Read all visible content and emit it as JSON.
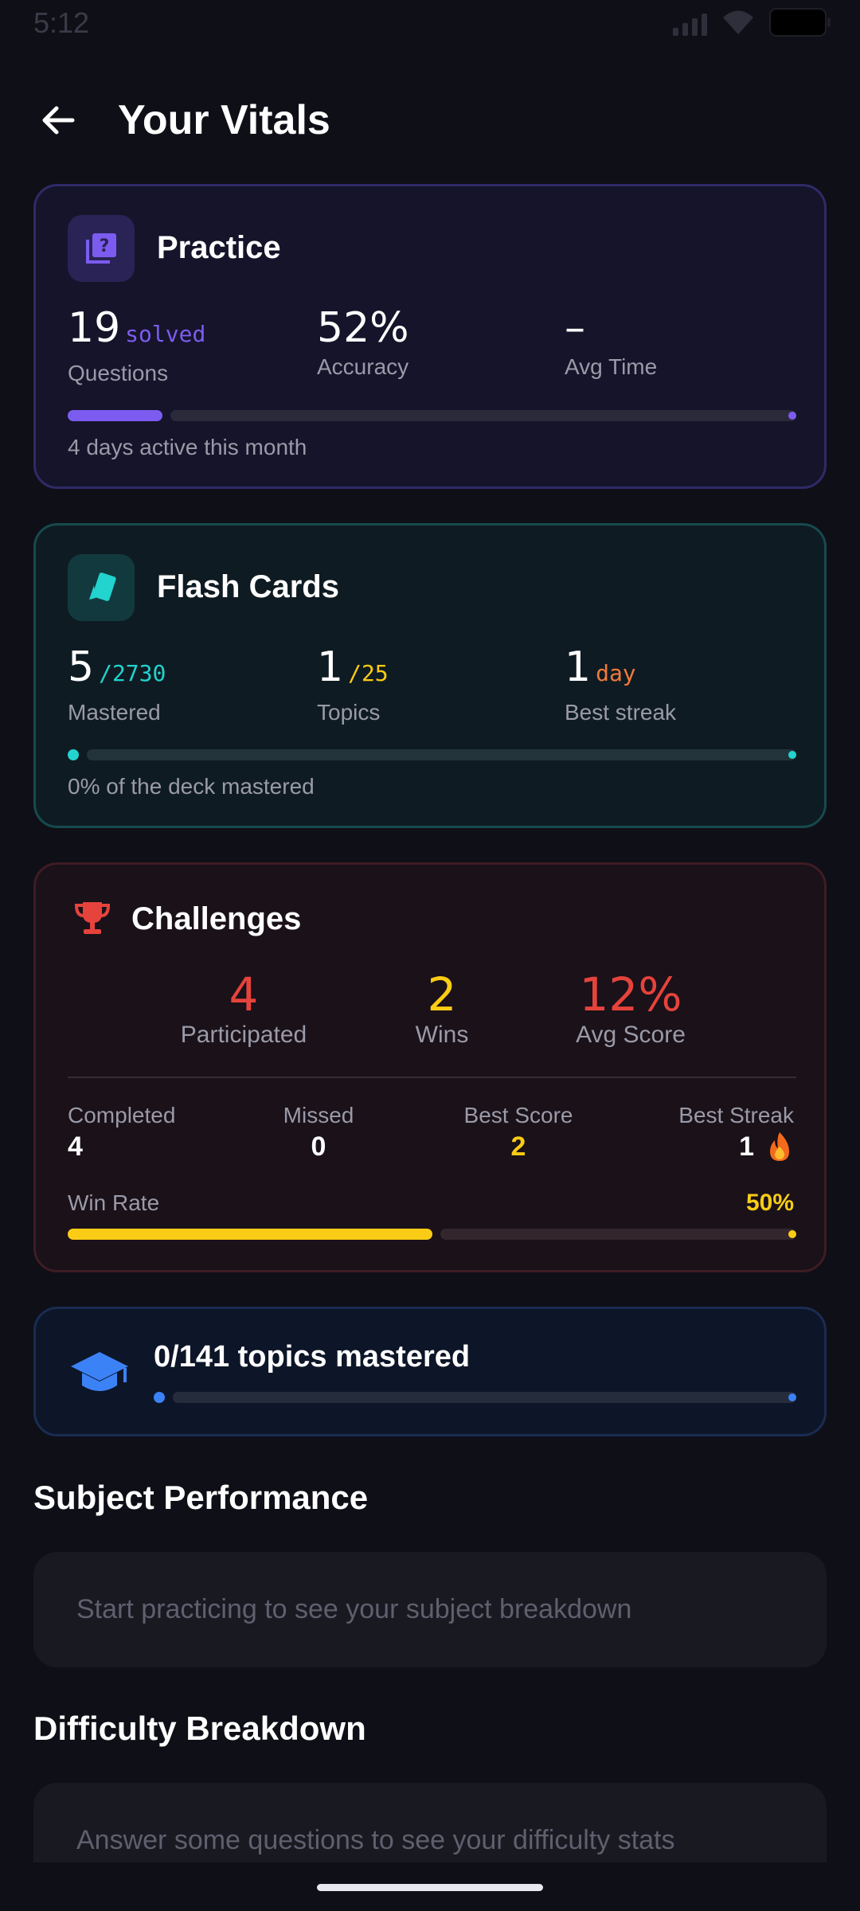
{
  "status_bar": {
    "time": "5:12"
  },
  "header": {
    "title": "Your Vitals"
  },
  "practice": {
    "title": "Practice",
    "stats": [
      {
        "value": "19",
        "suffix": "solved",
        "label": "Questions"
      },
      {
        "value": "52%",
        "suffix": "",
        "label": "Accuracy"
      },
      {
        "value": "–",
        "suffix": "",
        "label": "Avg Time"
      }
    ],
    "progress_fraction": 0.13,
    "footnote": "4 days active this month",
    "accent": "#7c5cf0"
  },
  "flash_cards": {
    "title": "Flash Cards",
    "stats": [
      {
        "value": "5",
        "suffix": "/2730",
        "label": "Mastered"
      },
      {
        "value": "1",
        "suffix": "/25",
        "label": "Topics"
      },
      {
        "value": "1",
        "suffix": "day",
        "label": "Best streak"
      }
    ],
    "progress_fraction": 0.0,
    "footnote": "0% of the deck mastered",
    "accent": "#22d3ce"
  },
  "challenges": {
    "title": "Challenges",
    "stats": [
      {
        "value": "4",
        "label": "Participated"
      },
      {
        "value": "2",
        "label": "Wins"
      },
      {
        "value": "12%",
        "label": "Avg Score"
      }
    ],
    "details": [
      {
        "label": "Completed",
        "value": "4"
      },
      {
        "label": "Missed",
        "value": "0"
      },
      {
        "label": "Best Score",
        "value": "2"
      },
      {
        "label": "Best Streak",
        "value": "1"
      }
    ],
    "win_rate_label": "Win Rate",
    "win_rate_value": "50%",
    "win_rate_fraction": 0.5,
    "colors": {
      "red": "#e5433c",
      "yellow": "#facc15"
    }
  },
  "topics": {
    "text": "0/141 topics mastered",
    "progress_fraction": 0.0,
    "accent": "#3b82f6"
  },
  "subject_performance": {
    "title": "Subject Performance",
    "empty_text": "Start practicing to see your subject breakdown"
  },
  "difficulty_breakdown": {
    "title": "Difficulty Breakdown",
    "empty_text": "Answer some questions to see your difficulty stats"
  }
}
